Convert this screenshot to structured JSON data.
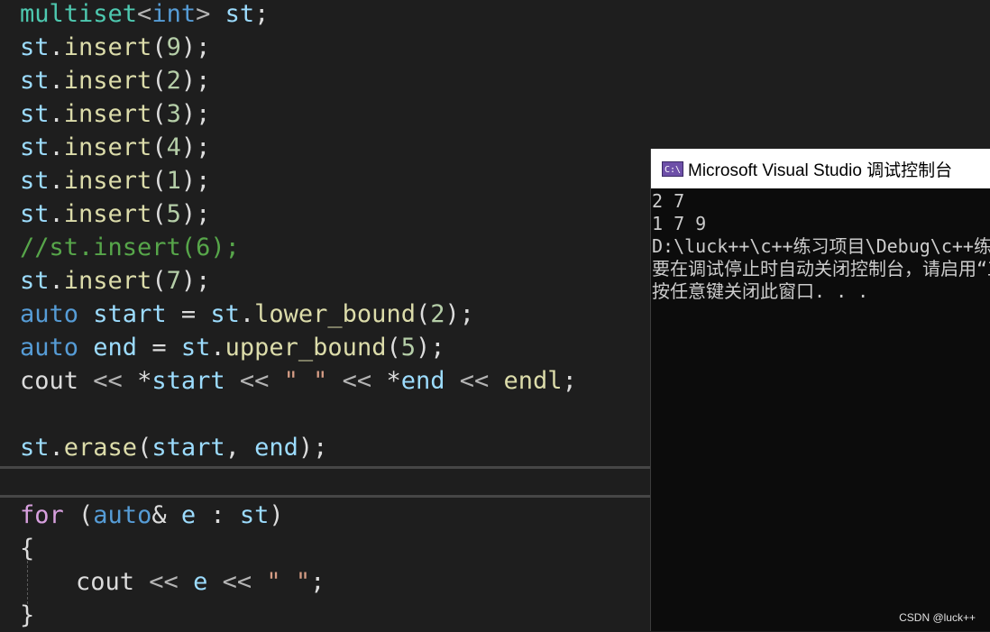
{
  "code": {
    "l1": [
      "multiset",
      "<",
      "int",
      ">",
      " ",
      "st",
      ";"
    ],
    "l2": [
      "st",
      ".",
      "insert",
      "(",
      "9",
      ");"
    ],
    "l3": [
      "st",
      ".",
      "insert",
      "(",
      "2",
      ");"
    ],
    "l4": [
      "st",
      ".",
      "insert",
      "(",
      "3",
      ");"
    ],
    "l5": [
      "st",
      ".",
      "insert",
      "(",
      "4",
      ");"
    ],
    "l6": [
      "st",
      ".",
      "insert",
      "(",
      "1",
      ");"
    ],
    "l7": [
      "st",
      ".",
      "insert",
      "(",
      "5",
      ");"
    ],
    "l8": [
      "//st.insert(6);"
    ],
    "l9": [
      "st",
      ".",
      "insert",
      "(",
      "7",
      ");"
    ],
    "l10": [
      "auto",
      " ",
      "start",
      " = ",
      "st",
      ".",
      "lower_bound",
      "(",
      "2",
      ");"
    ],
    "l11": [
      "auto",
      " ",
      "end",
      " = ",
      "st",
      ".",
      "upper_bound",
      "(",
      "5",
      ");"
    ],
    "l12": [
      "cout",
      " << ",
      "*",
      "start",
      " << ",
      "\" \"",
      " << ",
      "*",
      "end",
      " << ",
      "endl",
      ";"
    ],
    "l13": [
      "st",
      ".",
      "erase",
      "(",
      "start",
      ", ",
      "end",
      ");"
    ],
    "l14": [
      "for",
      " (",
      "auto",
      "&",
      " ",
      "e",
      " : ",
      "st",
      ")"
    ],
    "l15": [
      "{"
    ],
    "l16": [
      "cout",
      " << ",
      "e",
      " << ",
      "\" \"",
      ";"
    ],
    "l17": [
      "}"
    ]
  },
  "console": {
    "title": "Microsoft Visual Studio 调试控制台",
    "icon": "C:\\",
    "lines": [
      "2 7",
      "1 7 9",
      "D:\\luck++\\c++练习项目\\Debug\\c++练习项目.exe",
      "要在调试停止时自动关闭控制台，请启用“工具”",
      "按任意键关闭此窗口. . ."
    ]
  },
  "watermark": "CSDN @luck++",
  "colors": {
    "editor_bg": "#1e1e1e",
    "console_bg": "#0c0c0c",
    "type": "#4ec9b0",
    "variable": "#9cdcfe",
    "function": "#dcdcaa",
    "keyword": "#569cd6",
    "control": "#d8a0df",
    "number": "#b5cea8",
    "comment": "#57a64a",
    "string": "#d69d85"
  }
}
